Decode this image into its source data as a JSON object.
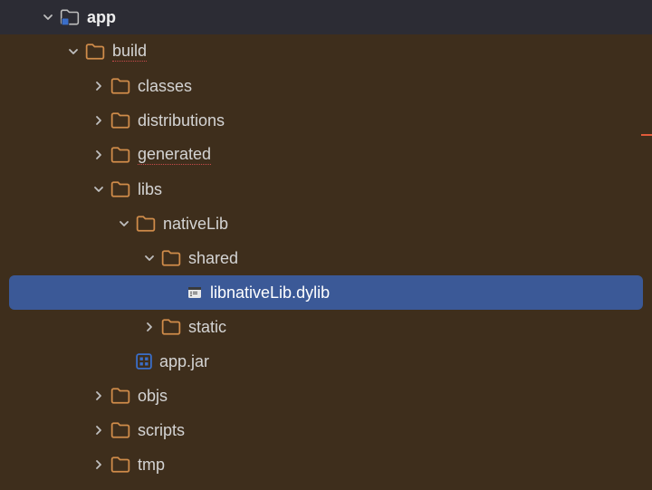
{
  "tree": {
    "app": {
      "label": "app",
      "expanded": true
    },
    "build": {
      "label": "build",
      "expanded": true,
      "underline": true
    },
    "classes": {
      "label": "classes",
      "expanded": false
    },
    "distributions": {
      "label": "distributions",
      "expanded": false
    },
    "generated": {
      "label": "generated",
      "expanded": false,
      "underline": true
    },
    "libs": {
      "label": "libs",
      "expanded": true
    },
    "nativeLib": {
      "label": "nativeLib",
      "expanded": true
    },
    "shared": {
      "label": "shared",
      "expanded": true
    },
    "libnativeLib": {
      "label": "libnativeLib.dylib",
      "selected": true
    },
    "static": {
      "label": "static",
      "expanded": false
    },
    "appjar": {
      "label": "app.jar"
    },
    "objs": {
      "label": "objs",
      "expanded": false
    },
    "scripts": {
      "label": "scripts",
      "expanded": false
    },
    "tmp": {
      "label": "tmp",
      "expanded": false
    }
  },
  "colors": {
    "folder": "#d08c4a",
    "selected": "#3b5997",
    "bg": "#3e2e1c"
  }
}
